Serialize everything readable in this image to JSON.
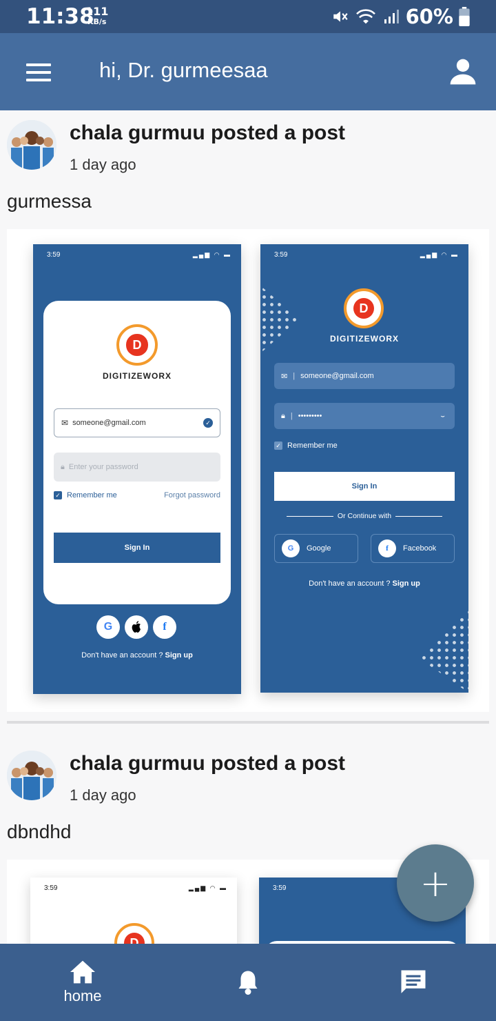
{
  "status_bar": {
    "time": "11:38",
    "net_speed_value": "111",
    "net_speed_unit": "KB/s",
    "battery": "60%"
  },
  "header": {
    "greeting": "hi, Dr. gurmeesaa"
  },
  "posts": [
    {
      "title": "chala gurmuu posted a post",
      "time": "1 day ago",
      "body": "gurmessa"
    },
    {
      "title": "chala gurmuu posted a post",
      "time": "1 day ago",
      "body": "dbndhd"
    }
  ],
  "mockup": {
    "time": "3:59",
    "brand": "DIGITIZEWORX",
    "email": "someone@gmail.com",
    "password_placeholder": "Enter your password",
    "password_mask": "•••••••••",
    "remember": "Remember me",
    "forgot": "Forgot password",
    "sign_in": "Sign In",
    "or_continue": "Or Continue with",
    "google": "Google",
    "facebook": "Facebook",
    "no_account": "Don't have an account ?",
    "sign_up": "Sign up"
  },
  "fab": {
    "label": "+"
  },
  "bottom_nav": {
    "home": "home"
  },
  "colors": {
    "status_bar": "#33527d",
    "app_bar": "#456d9f",
    "bottom_nav": "#3b5f8e",
    "fab": "#5c7c8e",
    "mock_blue": "#2b5f98"
  }
}
